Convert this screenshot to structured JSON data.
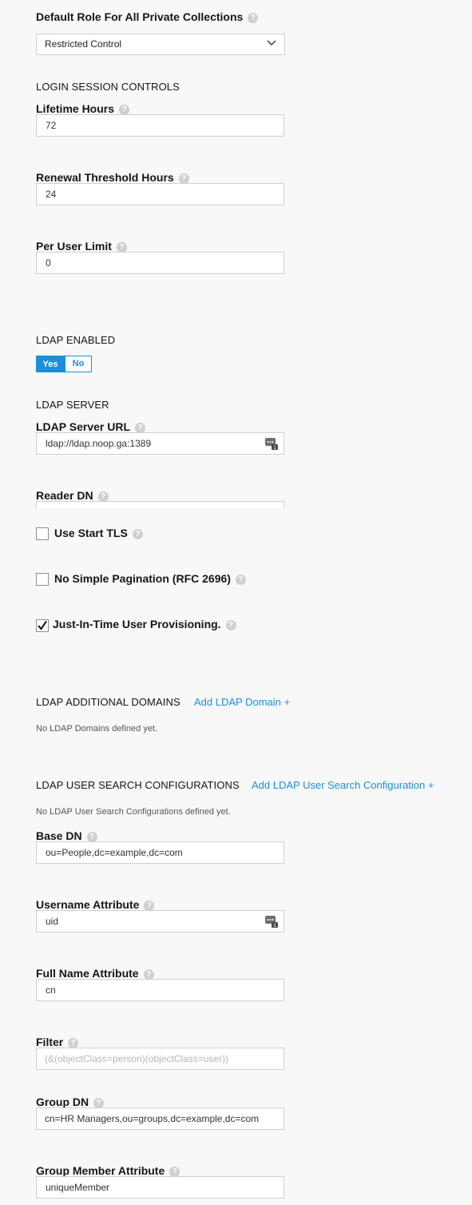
{
  "default_role": {
    "label": "Default Role For All Private Collections",
    "selected": "Restricted Control"
  },
  "login_session": {
    "section_title": "LOGIN SESSION CONTROLS",
    "lifetime_label": "Lifetime Hours",
    "lifetime_value": "72",
    "renewal_label": "Renewal Threshold Hours",
    "renewal_value": "24",
    "per_user_label": "Per User Limit",
    "per_user_value": "0"
  },
  "ldap_enabled": {
    "section_title": "LDAP ENABLED",
    "yes_label": "Yes",
    "no_label": "No",
    "selected": "Yes"
  },
  "ldap_server": {
    "section_title": "LDAP SERVER",
    "url_label": "LDAP Server URL",
    "url_value": "ldap://ldap.noop.ga:1389",
    "reader_dn_label": "Reader DN"
  },
  "checkboxes": [
    {
      "label": "Use Start TLS",
      "checked": false
    },
    {
      "label": "No Simple Pagination (RFC 2696)",
      "checked": false
    },
    {
      "label": "Just-In-Time User Provisioning.",
      "checked": true
    }
  ],
  "additional_domains": {
    "section_title": "LDAP ADDITIONAL DOMAINS",
    "add_link": "Add LDAP Domain +",
    "empty_text": "No LDAP Domains defined yet."
  },
  "user_search": {
    "section_title": "LDAP USER SEARCH CONFIGURATIONS",
    "add_link": "Add LDAP User Search Configuration +",
    "empty_text": "No LDAP User Search Configurations defined yet.",
    "base_dn_label": "Base DN",
    "base_dn_value": "ou=People,dc=example,dc=com",
    "username_attr_label": "Username Attribute",
    "username_attr_value": "uid",
    "full_name_attr_label": "Full Name Attribute",
    "full_name_attr_value": "cn",
    "filter_label": "Filter",
    "filter_placeholder": "(&(objectClass=person)(objectClass=user))",
    "group_dn_label": "Group DN",
    "group_dn_value": "cn=HR Managers,ou=groups,dc=example,dc=com",
    "group_member_attr_label": "Group Member Attribute",
    "group_member_attr_value": "uniqueMember"
  },
  "help_glyph": "?",
  "colors": {
    "accent": "#1b8fda",
    "help": "#cfcfcf",
    "border": "#cfcfcf",
    "background": "#f8f8f8"
  }
}
